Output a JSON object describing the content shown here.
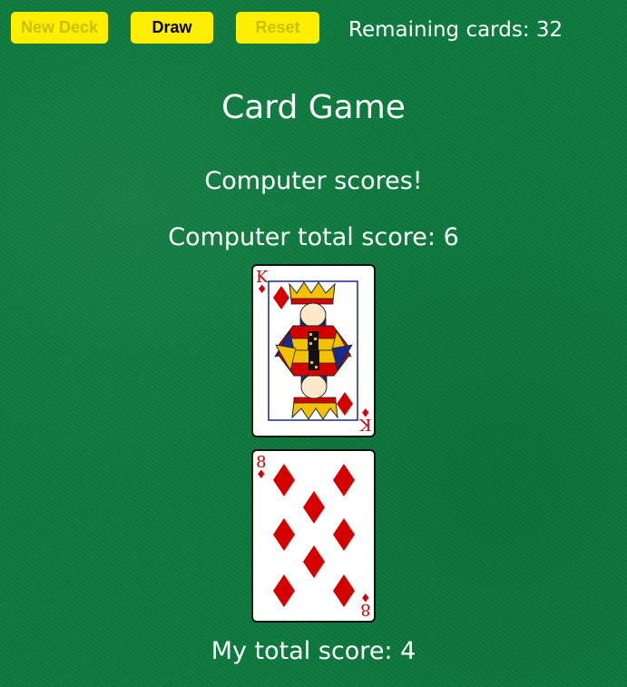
{
  "toolbar": {
    "new_deck_label": "New Deck",
    "draw_label": "Draw",
    "reset_label": "Reset",
    "remaining_text": "Remaining cards: 32"
  },
  "game": {
    "title": "Card Game",
    "message": "Computer scores!",
    "computer_score_text": "Computer total score: 6",
    "my_score_text": "My total score: 4"
  },
  "cards": {
    "computer": {
      "rank": "K",
      "suit": "♦",
      "suit_name": "diamonds",
      "color": "#d40000"
    },
    "player": {
      "rank": "8",
      "suit": "♦",
      "suit_name": "diamonds",
      "color": "#d40000"
    }
  },
  "colors": {
    "felt": "#0a7a3c",
    "button": "#ffee00",
    "button_disabled_text": "#c8c000",
    "card_red": "#d40000"
  },
  "icons": {
    "suit": "diamond-icon"
  }
}
